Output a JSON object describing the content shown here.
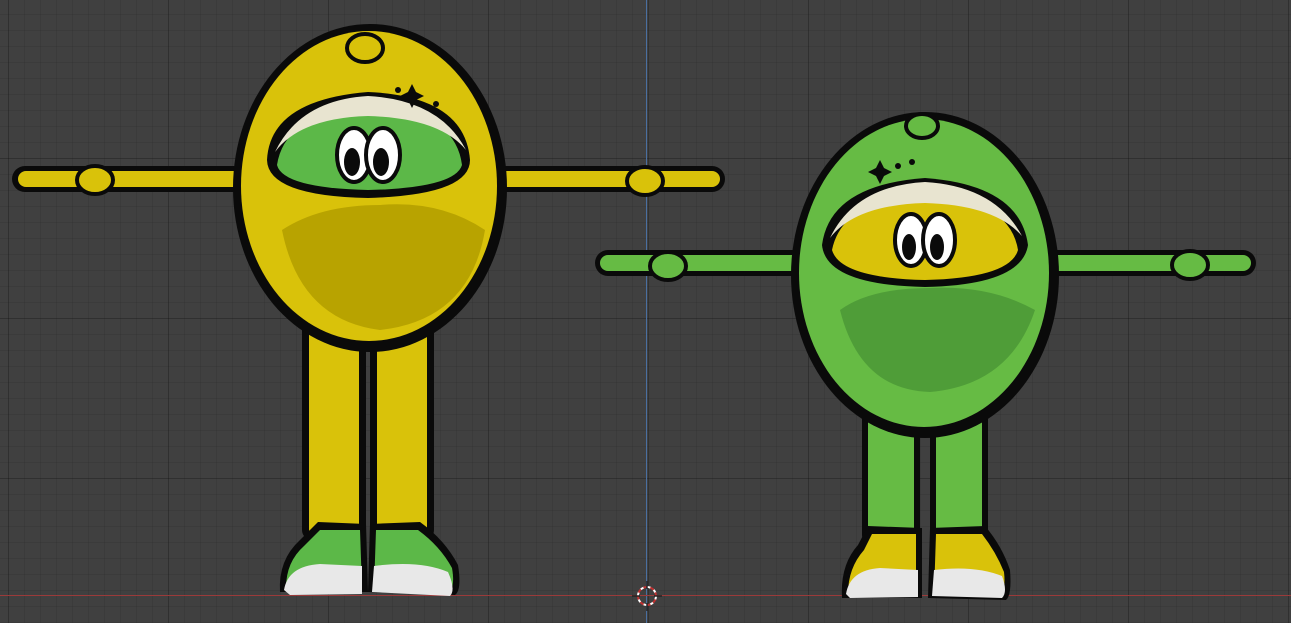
{
  "colors": {
    "viewport_bg": "#404040",
    "axis_x": "#9b3a3a",
    "axis_y": "#4a6fa0",
    "outline": "#0a0a0a",
    "lemon_body": "#d9c20a",
    "lemon_shade": "#b8a300",
    "lime_body": "#66bb44",
    "lime_shade": "#4f9d38",
    "shoe_white": "#e8e8e8",
    "shoe_grey": "#9a9a9a"
  },
  "viewport": {
    "grid": "on",
    "cursor_icon": "3d-cursor-icon"
  },
  "characters": [
    {
      "id": "lemon",
      "name_icon": "lemon-character",
      "body": "#d9c20a",
      "shade": "#b8a300",
      "visor": "#5cb848",
      "shoe_accent": "#5cb848"
    },
    {
      "id": "lime",
      "name_icon": "lime-character",
      "body": "#66bb44",
      "shade": "#4f9d38",
      "visor": "#d9c20a",
      "shoe_accent": "#d9c20a"
    }
  ]
}
